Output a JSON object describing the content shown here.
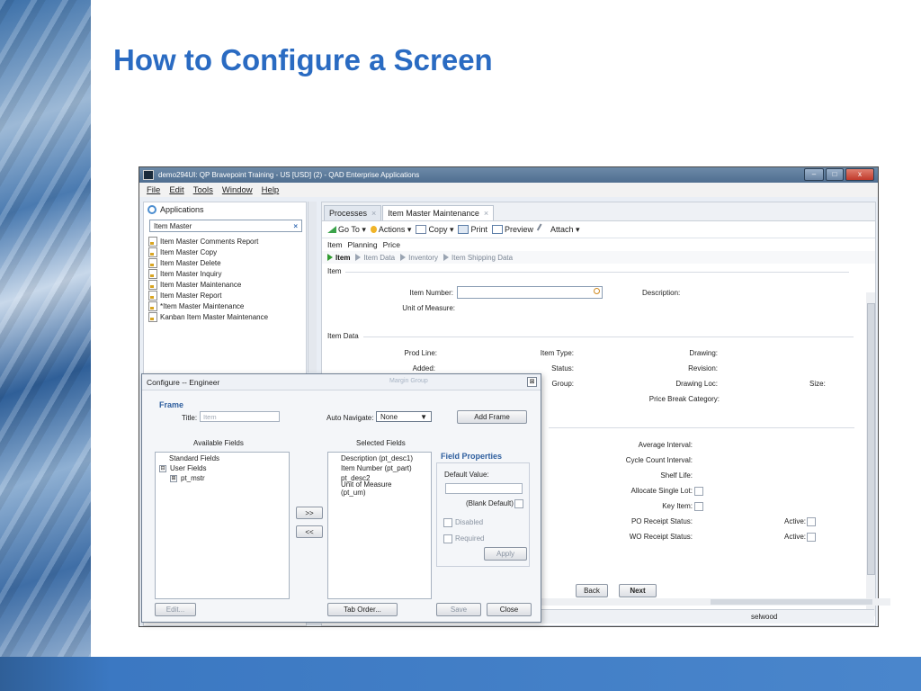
{
  "slide": {
    "title": "How to Configure a Screen"
  },
  "window": {
    "title": "demo294UI: QP Bravepoint Training - US [USD] (2) - QAD Enterprise Applications",
    "controls": [
      "–",
      "□",
      "x"
    ]
  },
  "menu": [
    "File",
    "Edit",
    "Tools",
    "Window",
    "Help"
  ],
  "left_pane": {
    "header": "Applications",
    "search_value": "Item Master",
    "search_clear": "×",
    "items": [
      "Item Master Comments Report",
      "Item Master Copy",
      "Item Master Delete",
      "Item Master Inquiry",
      "Item Master Maintenance",
      "Item Master Report",
      "*Item Master Maintenance",
      "Kanban Item Master Maintenance"
    ]
  },
  "tabs": [
    {
      "label": "Processes",
      "close": "×"
    },
    {
      "label": "Item Master Maintenance",
      "close": "×"
    }
  ],
  "toolbar": {
    "goto": "Go To",
    "actions": "Actions",
    "copy": "Copy",
    "print": "Print",
    "preview": "Preview",
    "attach": "Attach"
  },
  "subtabs": [
    "Item",
    "Planning",
    "Price"
  ],
  "breadcrumb": [
    "Item",
    "Item Data",
    "Inventory",
    "Item Shipping Data"
  ],
  "form": {
    "item_section": "Item",
    "item_number": "Item Number:",
    "description": "Description:",
    "uom": "Unit of Measure:",
    "item_data_section": "Item Data",
    "prod_line": "Prod Line:",
    "added": "Added:",
    "item_type": "Item Type:",
    "status": "Status:",
    "group": "Group:",
    "drawing": "Drawing:",
    "revision": "Revision:",
    "drawing_loc": "Drawing Loc:",
    "size": "Size:",
    "price_break": "Price Break Category:",
    "avg_interval": "Average Interval:",
    "cycle_count": "Cycle Count Interval:",
    "shelf_life": "Shelf Life:",
    "alloc_single": "Allocate Single Lot:",
    "key_item": "Key Item:",
    "po_receipt": "PO Receipt Status:",
    "wo_receipt": "WO Receipt Status:",
    "active1": "Active:",
    "active2": "Active:",
    "back": "Back",
    "next": "Next"
  },
  "status_user": "selwood",
  "dialog": {
    "title": "Configure -- Engineer",
    "faded_title": "Margin Group",
    "close": "⊠",
    "frame_label": "Frame",
    "title_label": "Title:",
    "title_placeholder": "Item",
    "auto_navigate_label": "Auto Navigate:",
    "auto_navigate_value": "None",
    "add_frame": "Add Frame",
    "available_fields": "Available Fields",
    "selected_fields": "Selected Fields",
    "tree": {
      "standard": "Standard Fields",
      "user": "User Fields",
      "pt_mstr": "pt_mstr",
      "minus": "⊟",
      "plus": "⊞"
    },
    "selected": [
      "Description (pt_desc1)",
      "Item Number (pt_part)",
      "pt_desc2",
      "Unit of Measure (pt_um)"
    ],
    "move_right": ">>",
    "move_left": "<<",
    "field_properties": "Field Properties",
    "default_value": "Default Value:",
    "blank_default": "(Blank Default)",
    "disabled": "Disabled",
    "required": "Required",
    "apply": "Apply",
    "edit": "Edit...",
    "tab_order": "Tab Order...",
    "save": "Save",
    "close_btn": "Close"
  }
}
